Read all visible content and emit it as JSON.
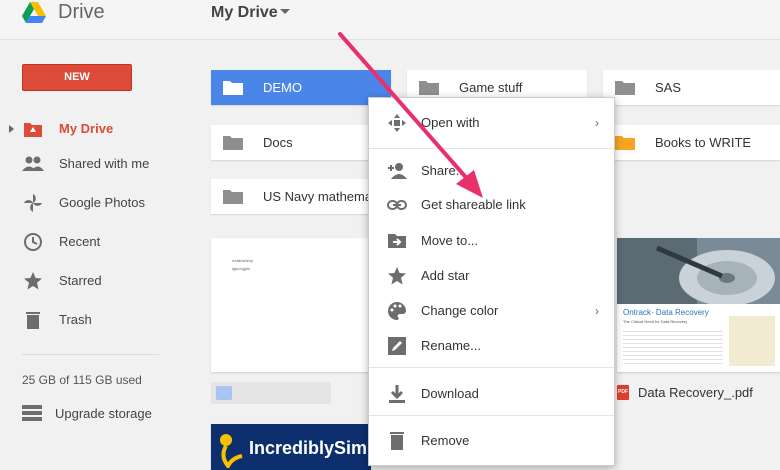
{
  "header": {
    "app_name": "Drive",
    "location_title": "My Drive"
  },
  "sidebar": {
    "new_label": "NEW",
    "items": [
      {
        "label": "My Drive",
        "icon": "my-drive-icon",
        "active": true
      },
      {
        "label": "Shared with me",
        "icon": "people-icon"
      },
      {
        "label": "Google Photos",
        "icon": "photos-pinwheel-icon"
      },
      {
        "label": "Recent",
        "icon": "clock-icon"
      },
      {
        "label": "Starred",
        "icon": "star-icon"
      },
      {
        "label": "Trash",
        "icon": "trash-icon"
      }
    ],
    "storage_text": "25 GB of 115 GB used",
    "upgrade_label": "Upgrade storage"
  },
  "folders": [
    {
      "name": "DEMO",
      "color": "#ffffff",
      "selected": true
    },
    {
      "name": "Game stuff",
      "color": "#8f8f8f"
    },
    {
      "name": "SAS",
      "color": "#8f8f8f"
    },
    {
      "name": "Docs",
      "color": "#8f8f8f"
    },
    {
      "name": "Books to WRITE",
      "color": "#f6a623"
    },
    {
      "name": "US Navy mathema",
      "color": "#8f8f8f"
    }
  ],
  "files": {
    "doc_preview_line1": "Anfänsheny",
    "doc_preview_line2": "lglpougjdn",
    "pdf_title": "Ontrack· Data Recovery",
    "pdf_subtitle": "The Critical Need for Data Recovery",
    "pdf_badge": "PDF",
    "pdf_name": "Data Recovery_.pdf",
    "banner_text": "IncrediblySim"
  },
  "context_menu": {
    "items": [
      {
        "label": "Open with",
        "icon": "open-with-icon",
        "submenu": true
      },
      {
        "label": "Share...",
        "icon": "share-person-icon"
      },
      {
        "label": "Get shareable link",
        "icon": "link-icon"
      },
      {
        "label": "Move to...",
        "icon": "move-folder-icon"
      },
      {
        "label": "Add star",
        "icon": "star-icon"
      },
      {
        "label": "Change color",
        "icon": "palette-icon",
        "submenu": true
      },
      {
        "label": "Rename...",
        "icon": "rename-pencil-icon"
      },
      {
        "label": "Download",
        "icon": "download-icon"
      },
      {
        "label": "Remove",
        "icon": "trash-icon"
      }
    ],
    "submenu_arrow": "›"
  },
  "colors": {
    "accent_red": "#dd4b39",
    "selected_blue": "#4a86e8",
    "annotation_arrow": "#e8306b"
  }
}
